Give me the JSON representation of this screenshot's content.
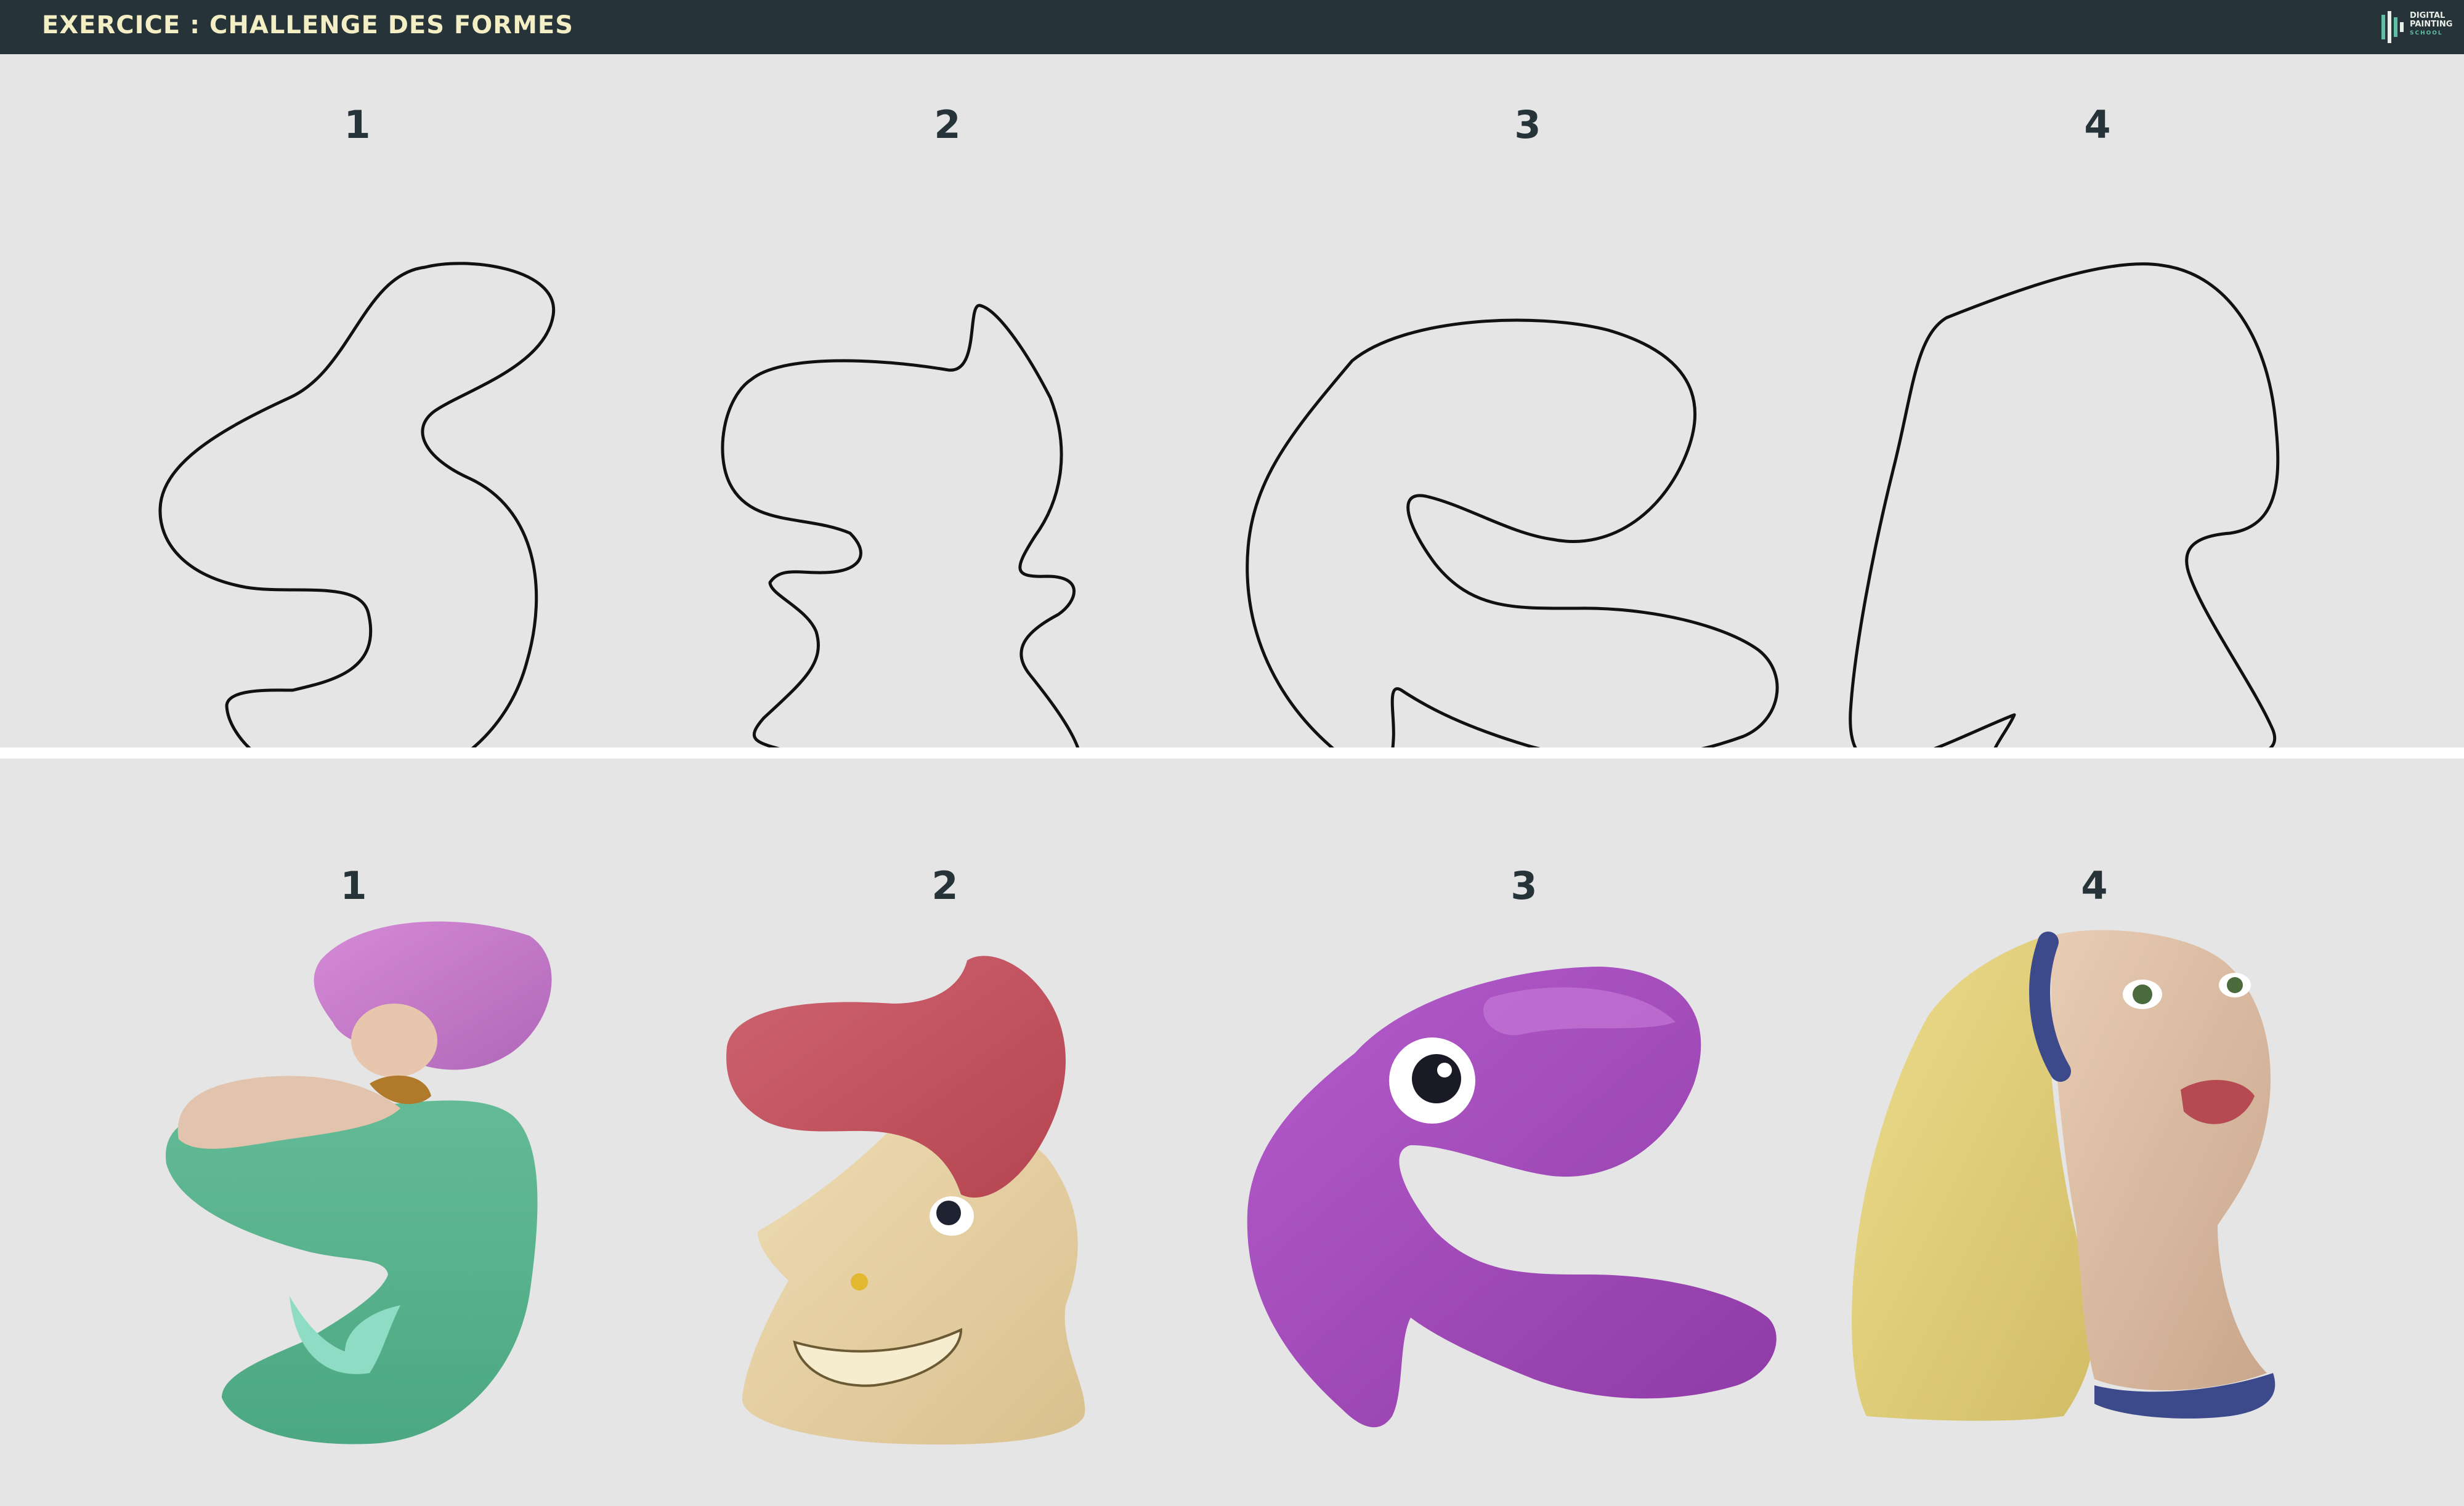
{
  "header": {
    "title": "EXERCICE : CHALLENGE DES FORMES",
    "logo": {
      "line1": "DIGITAL",
      "line2": "PAINTING",
      "line3": "SCHOOL"
    },
    "background": "#263338",
    "title_color": "#f3eec4"
  },
  "shapes_panel": {
    "background": "#e5e5e5",
    "labels": [
      "1",
      "2",
      "3",
      "4"
    ]
  },
  "paintings_panel": {
    "background": "#e5e5e5",
    "labels": [
      "1",
      "2",
      "3",
      "4"
    ],
    "subjects": [
      "mermaid",
      "grinning-man-red-hair",
      "purple-octopus",
      "girl-with-headscarf"
    ]
  },
  "colors": {
    "mermaid_hair": "#c77bc9",
    "mermaid_tail": "#5fb894",
    "man_hair": "#c4545f",
    "skin": "#e4cfa2",
    "octopus": "#a04ab8",
    "scarf": "#e6d47c",
    "headband": "#3c4a8c"
  }
}
